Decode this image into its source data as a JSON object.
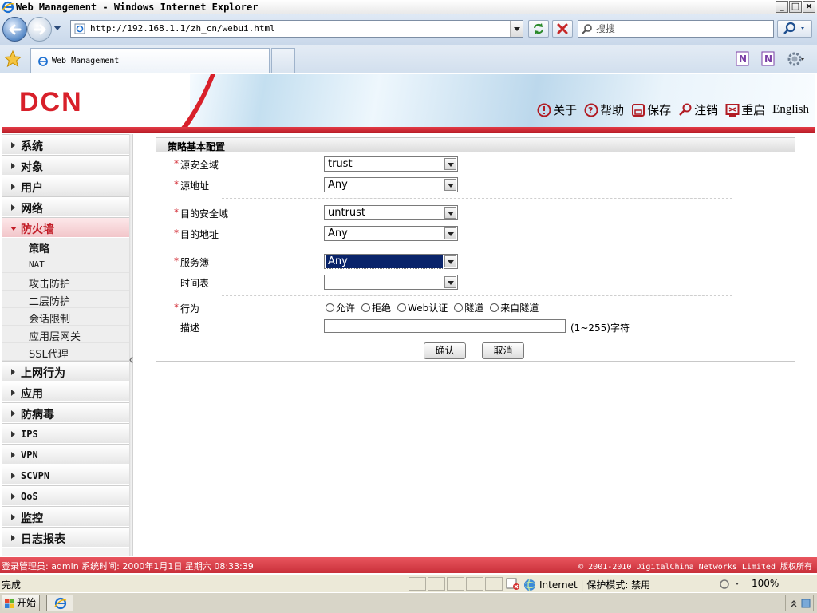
{
  "window": {
    "title": "Web Management - Windows Internet Explorer",
    "controls": [
      "_",
      "□",
      "×"
    ]
  },
  "browser": {
    "url": "http://192.168.1.1/zh_cn/webui.html",
    "search_placeholder": "搜搜",
    "tab_title": "Web Management"
  },
  "app": {
    "logo": "DCN",
    "actions": [
      {
        "label": "关于",
        "icon": "info-icon"
      },
      {
        "label": "帮助",
        "icon": "help-icon"
      },
      {
        "label": "保存",
        "icon": "save-icon"
      },
      {
        "label": "注销",
        "icon": "logout-key-icon"
      },
      {
        "label": "重启",
        "icon": "reboot-icon"
      },
      {
        "label": "English",
        "icon": ""
      }
    ]
  },
  "sidebar": {
    "items_top": [
      "系统",
      "对象",
      "用户",
      "网络"
    ],
    "open_item": "防火墙",
    "sub_items": [
      "策略",
      "NAT",
      "攻击防护",
      "二层防护",
      "会话限制",
      "应用层网关",
      "SSL代理"
    ],
    "active_sub": "策略",
    "items_bottom": [
      "上网行为",
      "应用",
      "防病毒",
      "IPS",
      "VPN",
      "SCVPN",
      "QoS",
      "监控",
      "日志报表"
    ]
  },
  "form": {
    "title": "策略基本配置",
    "required_mark": "*",
    "src_zone": {
      "label": "源安全域",
      "value": "trust"
    },
    "src_addr": {
      "label": "源地址",
      "value": "Any"
    },
    "dst_zone": {
      "label": "目的安全域",
      "value": "untrust"
    },
    "dst_addr": {
      "label": "目的地址",
      "value": "Any"
    },
    "service": {
      "label": "服务簿",
      "value": "Any"
    },
    "schedule": {
      "label": "时间表",
      "value": ""
    },
    "action": {
      "label": "行为",
      "options": [
        "允许",
        "拒绝",
        "Web认证",
        "隧道",
        "来自隧道"
      ]
    },
    "description": {
      "label": "描述",
      "value": "",
      "hint": "(1~255)字符"
    },
    "ok_label": "确认",
    "cancel_label": "取消"
  },
  "footer": {
    "left": "登录管理员: admin 系统时间: 2000年1月1日 星期六 08:33:39",
    "right": "© 2001-2010 DigitalChina Networks Limited 版权所有"
  },
  "statusbar": {
    "done": "完成",
    "zone": "Internet | 保护模式: 禁用",
    "zoom": "100%"
  },
  "taskbar": {
    "start": "开始"
  },
  "colors": {
    "brand_red": "#d8202a",
    "selection_blue": "#0a246a"
  }
}
